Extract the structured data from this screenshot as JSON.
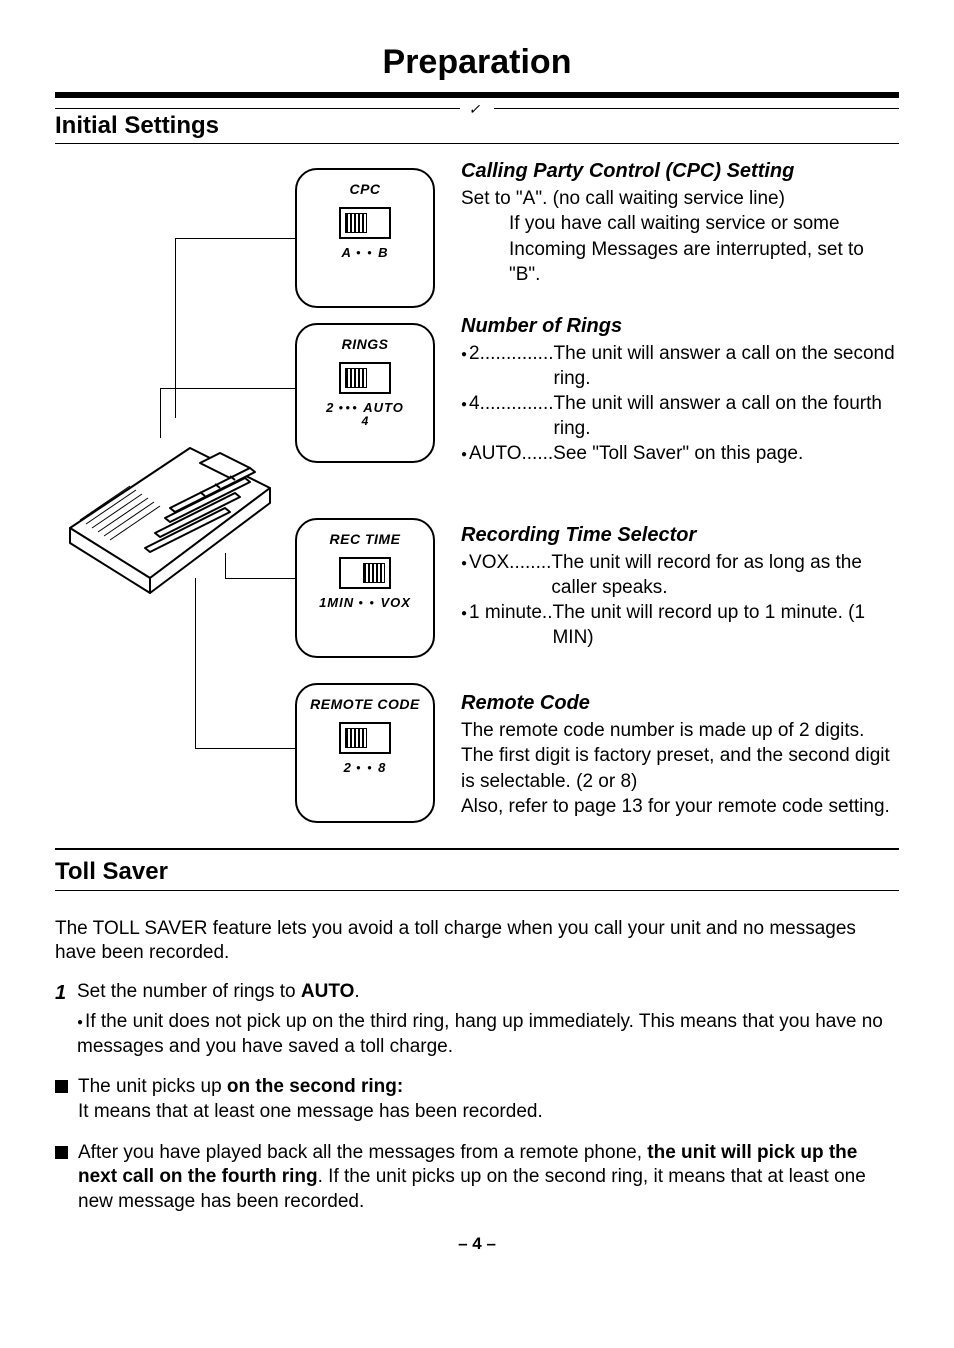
{
  "title": "Preparation",
  "section1": "Initial Settings",
  "callouts": {
    "cpc": {
      "top": "CPC",
      "a": "A",
      "b": "B"
    },
    "rings": {
      "top": "RINGS",
      "l": "2",
      "r": "AUTO",
      "sub": "4"
    },
    "rec": {
      "top": "REC TIME",
      "l": "1MIN",
      "r": "VOX"
    },
    "remote": {
      "top": "REMOTE CODE",
      "l": "2",
      "r": "8"
    }
  },
  "cpc": {
    "title": "Calling Party Control (CPC) Setting",
    "line1": "Set to \"A\". (no call waiting service line)",
    "line2": "If you have call waiting service or some Incoming Messages are interrupted, set to \"B\"."
  },
  "rings": {
    "title": "Number of Rings",
    "r2a": "2..............",
    "r2b": "The unit will answer a call on the second ring.",
    "r4a": "4..............",
    "r4b": "The unit will answer a call on the fourth ring.",
    "raa": "AUTO......",
    "rab": "See \"Toll Saver\" on this page."
  },
  "rec": {
    "title": "Recording Time Selector",
    "voxa": "VOX........",
    "voxb": "The unit will record for as long as the caller speaks.",
    "m1a": "1 minute..",
    "m1b": "The unit will record up to 1 minute. (1 MIN)"
  },
  "remote": {
    "title": "Remote Code",
    "l1": "The remote code number is made up of 2 digits.",
    "l2": "The first digit is factory preset, and the second digit is selectable. (2 or 8)",
    "l3": "Also, refer to page 13 for your remote code setting."
  },
  "section2": "Toll Saver",
  "ts": {
    "intro": "The TOLL SAVER feature lets you avoid a toll charge when you call your unit and no messages have been recorded.",
    "step1a": "Set the number of rings to ",
    "step1b": "AUTO",
    "step1c": ".",
    "step1sub": "If the unit does not pick up on the third ring, hang up immediately. This means that you have no messages and you have saved a toll charge.",
    "b1a": "The unit picks up ",
    "b1b": "on the second ring:",
    "b1c": "It means that at least one message has been recorded.",
    "b2a": "After you have played back all the messages from a remote phone, ",
    "b2b": "the unit will pick up the next call on the fourth ring",
    "b2c": ". If the unit picks up on the second ring, it means that at least one new message has been recorded."
  },
  "pagenum": "– 4 –"
}
